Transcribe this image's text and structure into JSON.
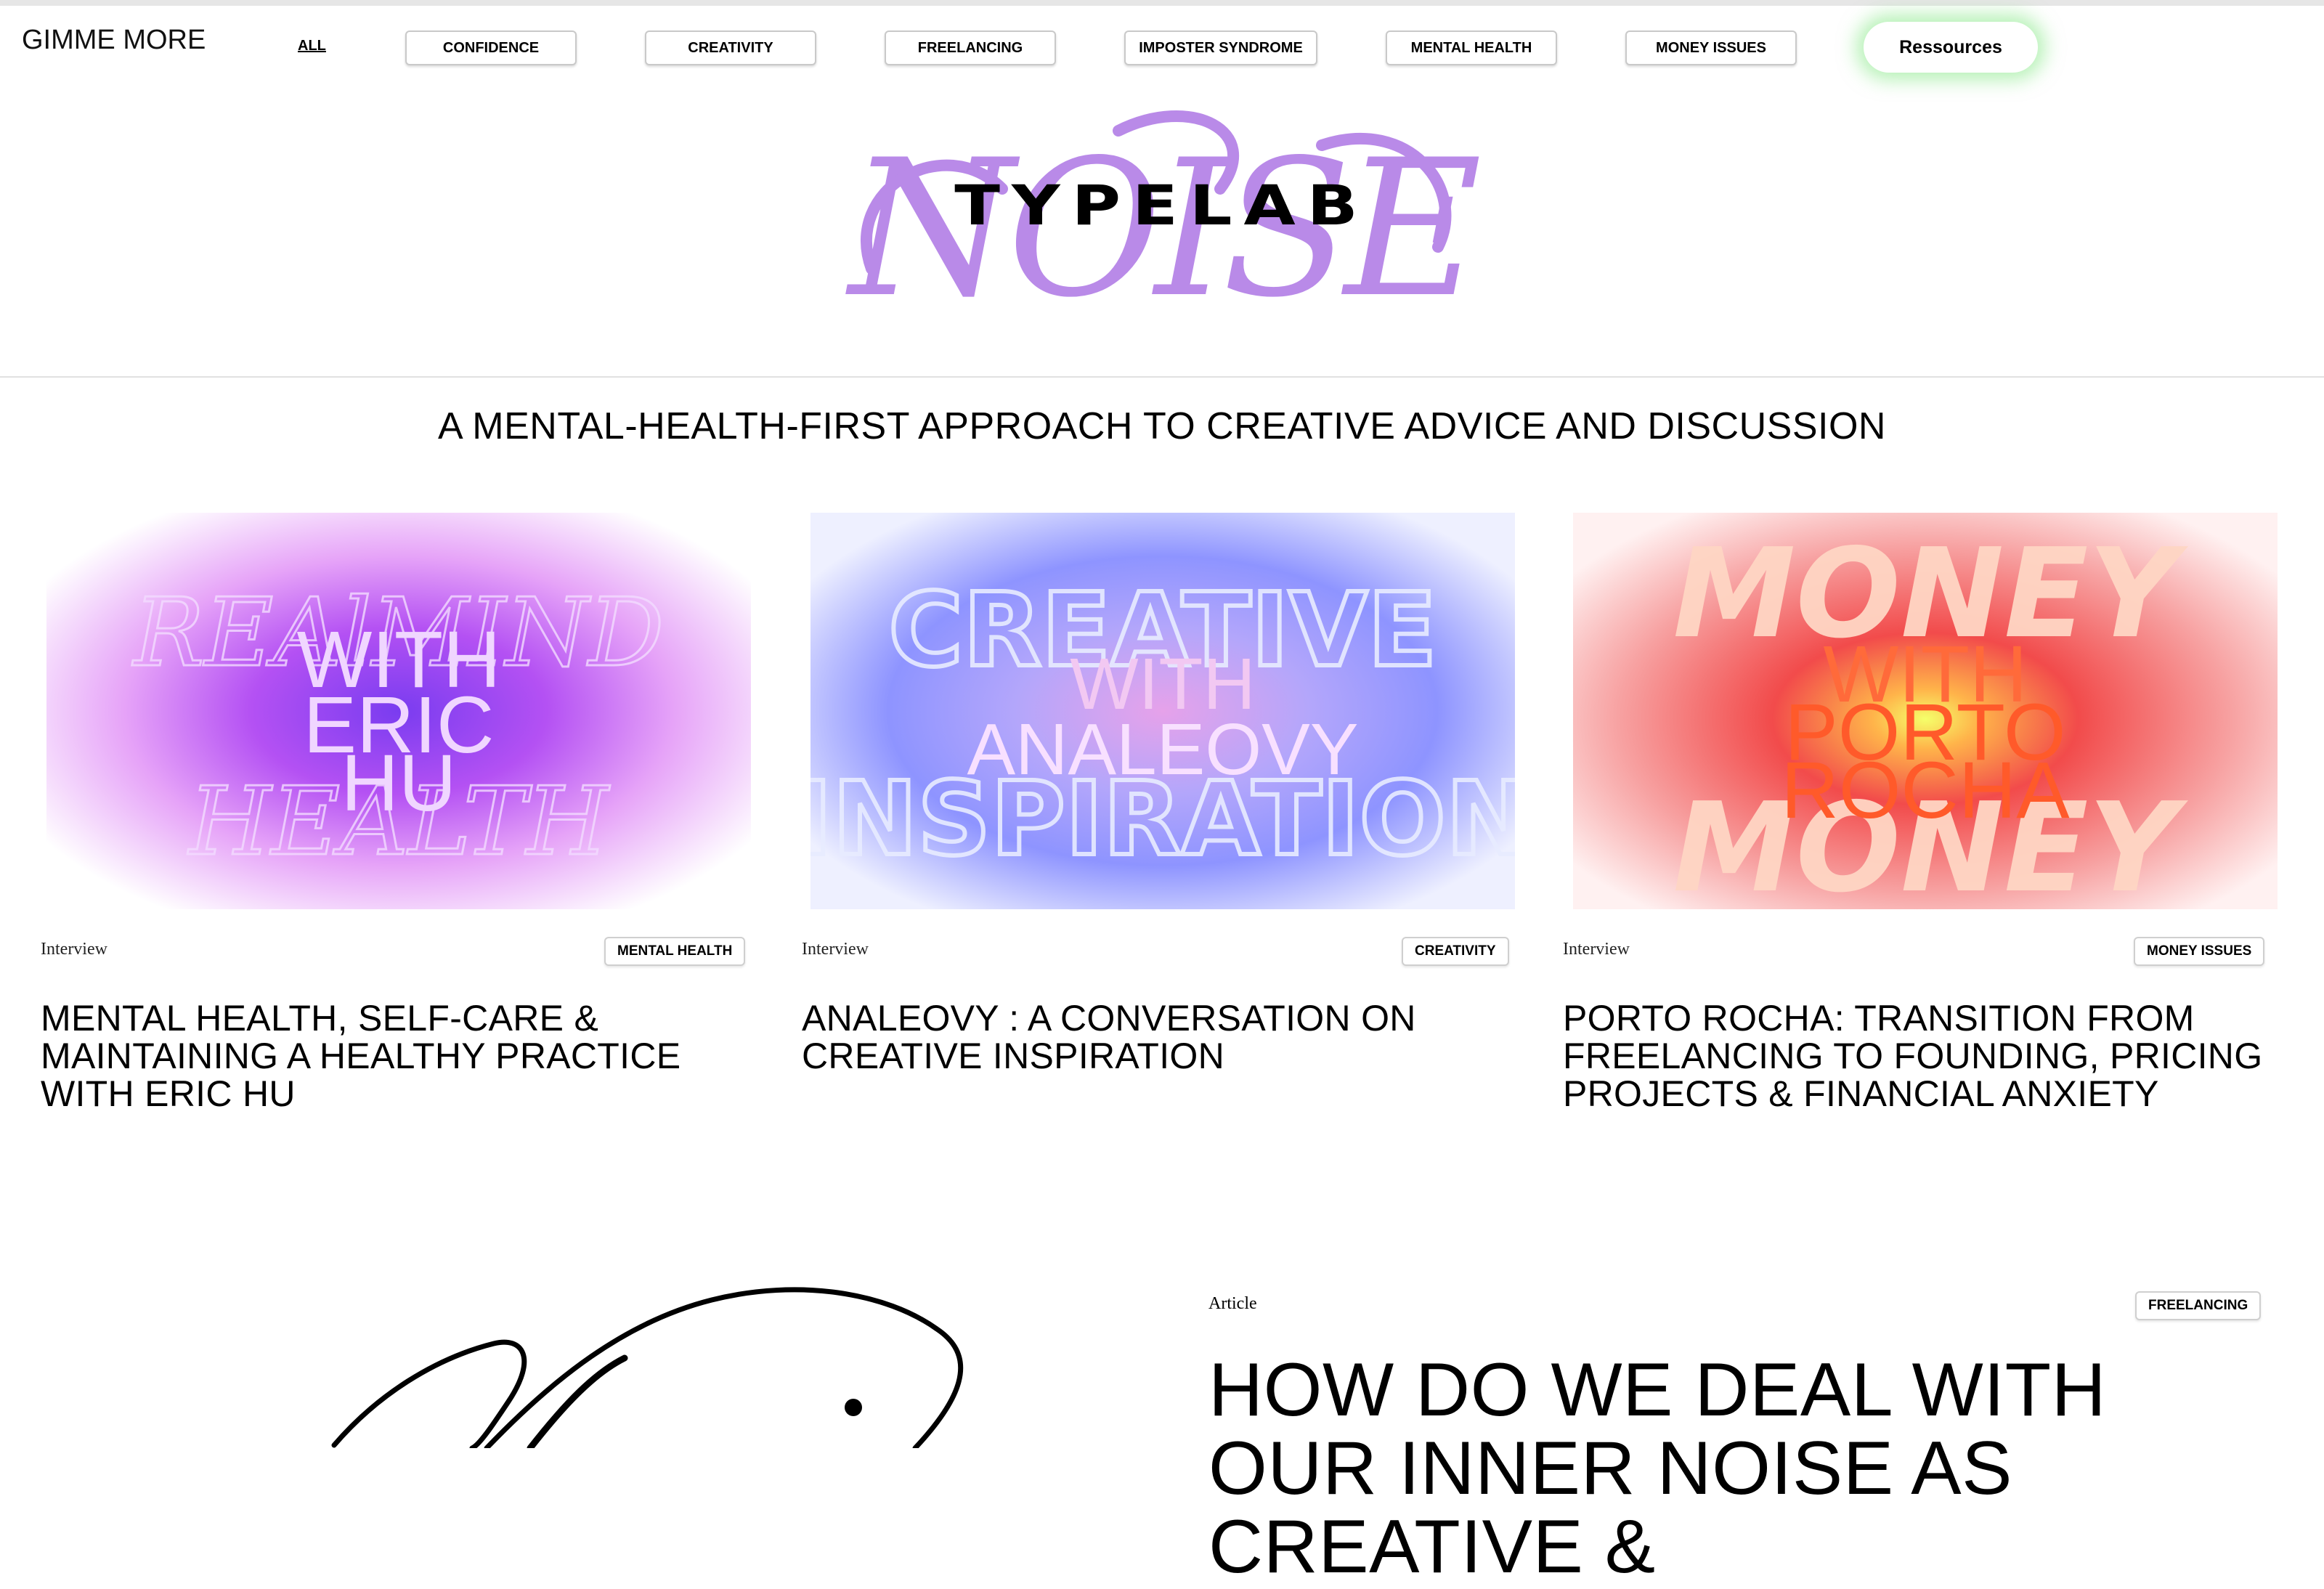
{
  "brand": "GIMME MORE",
  "nav": {
    "all_label": "ALL",
    "categories": [
      "CONFIDENCE",
      "CREATIVITY",
      "FREELANCING",
      "IMPOSTER SYNDROME",
      "MENTAL HEALTH",
      "MONEY ISSUES"
    ],
    "resources_label": "Ressources"
  },
  "hero": {
    "logo_word": "NOISE",
    "logo_overlay": "TYPELAB",
    "accent_color": "#b98ae8"
  },
  "tagline": "A MENTAL-HEALTH-FIRST APPROACH TO CREATIVE ADVICE AND DISCUSSION",
  "cards": [
    {
      "type": "Interview",
      "tag": "MENTAL HEALTH",
      "title": "MENTAL HEALTH, SELF-CARE & MAINTAINING A HEALTHY PRACTICE WITH ERIC HU",
      "image_text_1": "WITH",
      "image_text_2": "ERIC",
      "image_text_3": "HU",
      "colors": [
        "#c46cf5",
        "#8a4ce8",
        "#f2d4ff"
      ]
    },
    {
      "type": "Interview",
      "tag": "CREATIVITY",
      "title": "ANALEOVY : A CONVERSATION ON CREATIVE INSPIRATION",
      "image_text_1": "CREATIVE",
      "image_text_2": "WITH",
      "image_text_3": "ANALEOVY",
      "image_text_4": "INSPIRATION",
      "colors": [
        "#9a9cff",
        "#e59ef0",
        "#dfe4ff"
      ]
    },
    {
      "type": "Interview",
      "tag": "MONEY ISSUES",
      "title": "PORTO ROCHA: TRANSITION FROM FREELANCING TO FOUNDING, PRICING PROJECTS & FINANCIAL ANXIETY",
      "image_text_1": "MONEY",
      "image_text_2": "WITH",
      "image_text_3": "PORTO",
      "image_text_4": "ROCHA",
      "colors": [
        "#f24b4b",
        "#f7e84a",
        "#ffe2e2"
      ]
    }
  ],
  "article": {
    "type": "Article",
    "tag": "FREELANCING",
    "title": "HOW DO WE DEAL WITH OUR INNER NOISE AS CREATIVE &"
  }
}
